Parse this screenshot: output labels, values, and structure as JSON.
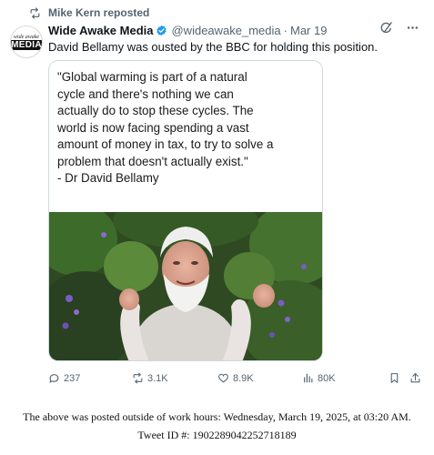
{
  "repost": {
    "text": "Mike Kern reposted",
    "icon": "repost-icon"
  },
  "author": {
    "display_name": "Wide Awake Media",
    "handle": "@wideawake_media",
    "separator": "·",
    "date": "Mar 19",
    "avatar_small_text": "wide awake",
    "avatar_big_text": "MEDIA"
  },
  "tweet": {
    "text": "David Bellamy was ousted by the BBC for holding this position."
  },
  "media": {
    "quote_text": "\"Global warming is part of a natural\ncycle and there's nothing we can\nactually do to stop these cycles. The\nworld is now facing spending a vast\namount of money in tax, to try to solve a\nproblem that doesn't actually exist.\"\n- Dr David Bellamy"
  },
  "actions": {
    "replies": "237",
    "reposts": "3.1K",
    "likes": "8.9K",
    "views": "80K"
  },
  "caption": {
    "line1": "The above was posted outside of work hours: Wednesday, March 19, 2025, at 03:20 AM.",
    "line2": "Tweet ID #: 1902289042252718189"
  },
  "colors": {
    "verified": "#1d9bf0",
    "muted": "#536471",
    "text": "#0f1419"
  }
}
